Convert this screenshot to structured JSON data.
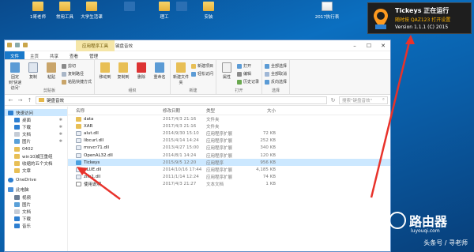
{
  "desktop": {
    "icons": [
      {
        "label": "1哥老师"
      },
      {
        "label": "常用工具"
      },
      {
        "label": "大学生活课"
      },
      {
        "label": ""
      },
      {
        "label": "理工"
      },
      {
        "label": ""
      },
      {
        "label": "安装"
      },
      {
        "label": "2017执行表"
      }
    ]
  },
  "tickeys_note": {
    "title": "Tickeys 正在运行",
    "hotkey": "随时按 QAZ123 打开设置",
    "version": "Version 1.1.1 (C) 2015"
  },
  "window": {
    "context_tab": "应用程序工具",
    "title": "键盘音效",
    "ribbon_tabs": [
      "文件",
      "主页",
      "共享",
      "查看",
      "管理"
    ],
    "groups": [
      {
        "name": "剪贴板",
        "big": [
          "固定到'快速访问'",
          "复制",
          "粘贴"
        ],
        "small": [
          "剪切",
          "复制路径",
          "粘贴快捷方式"
        ]
      },
      {
        "name": "组织",
        "big": [
          "移动到",
          "复制到",
          "删除",
          "重命名"
        ]
      },
      {
        "name": "新建",
        "big": [
          "新建文件夹"
        ],
        "small": [
          "新建项目",
          "轻松访问"
        ]
      },
      {
        "name": "打开",
        "big": [
          "属性"
        ],
        "small": [
          "打开",
          "编辑",
          "历史记录"
        ]
      },
      {
        "name": "选择",
        "small": [
          "全部选择",
          "全部取消",
          "反向选择"
        ]
      }
    ],
    "address": "键盘音效",
    "search_placeholder": "搜索\"键盘音效\"",
    "columns": {
      "name": "名称",
      "date": "修改日期",
      "type": "类型",
      "size": "大小"
    },
    "nav_items": [
      {
        "label": "快速访问",
        "level": 0
      },
      {
        "label": "桌面",
        "level": 1
      },
      {
        "label": "下载",
        "level": 1
      },
      {
        "label": "文档",
        "level": 1
      },
      {
        "label": "图片",
        "level": 1
      },
      {
        "label": "0402",
        "level": 1
      },
      {
        "label": "win10减压重组",
        "level": 1
      },
      {
        "label": "收缩的五个文档",
        "level": 1
      },
      {
        "label": "文章",
        "level": 1
      },
      {
        "label": "OneDrive",
        "level": 0
      },
      {
        "label": "此电脑",
        "level": 0
      },
      {
        "label": "视频",
        "level": 1
      },
      {
        "label": "图片",
        "level": 1
      },
      {
        "label": "文档",
        "level": 1
      },
      {
        "label": "下载",
        "level": 1
      },
      {
        "label": "音乐",
        "level": 1
      }
    ],
    "files": [
      {
        "name": "data",
        "date": "2017/4/3 21:16",
        "type": "文件夹",
        "size": "",
        "icon": "folder"
      },
      {
        "name": "XAR",
        "date": "2017/4/3 21:16",
        "type": "文件夹",
        "size": "",
        "icon": "folder"
      },
      {
        "name": "alut.dll",
        "date": "2014/9/30 15:10",
        "type": "应用程序扩展",
        "size": "72 KB",
        "icon": "dll"
      },
      {
        "name": "libcurl.dll",
        "date": "2015/4/14 14:24",
        "type": "应用程序扩展",
        "size": "252 KB",
        "icon": "dll"
      },
      {
        "name": "msvcr71.dll",
        "date": "2013/4/27 15:00",
        "type": "应用程序扩展",
        "size": "340 KB",
        "icon": "dll"
      },
      {
        "name": "OpenAL32.dll",
        "date": "2014/8/1 14:24",
        "type": "应用程序扩展",
        "size": "120 KB",
        "icon": "dll"
      },
      {
        "name": "Tickeys",
        "date": "2015/9/5 12:20",
        "type": "应用程序",
        "size": "956 KB",
        "icon": "exe",
        "selected": true
      },
      {
        "name": "XLUE.dll",
        "date": "2014/10/16 17:44",
        "type": "应用程序扩展",
        "size": "4,185 KB",
        "icon": "dll"
      },
      {
        "name": "zlib1.dll",
        "date": "2011/1/14 12:24",
        "type": "应用程序扩展",
        "size": "74 KB",
        "icon": "dll"
      },
      {
        "name": "使用说明",
        "date": "2017/4/3 21:27",
        "type": "文本文档",
        "size": "1 KB",
        "icon": "txt"
      }
    ]
  },
  "watermark": {
    "title": "路由器",
    "url": "luyouqi.com",
    "byline": "头条号 / 寻老师"
  }
}
